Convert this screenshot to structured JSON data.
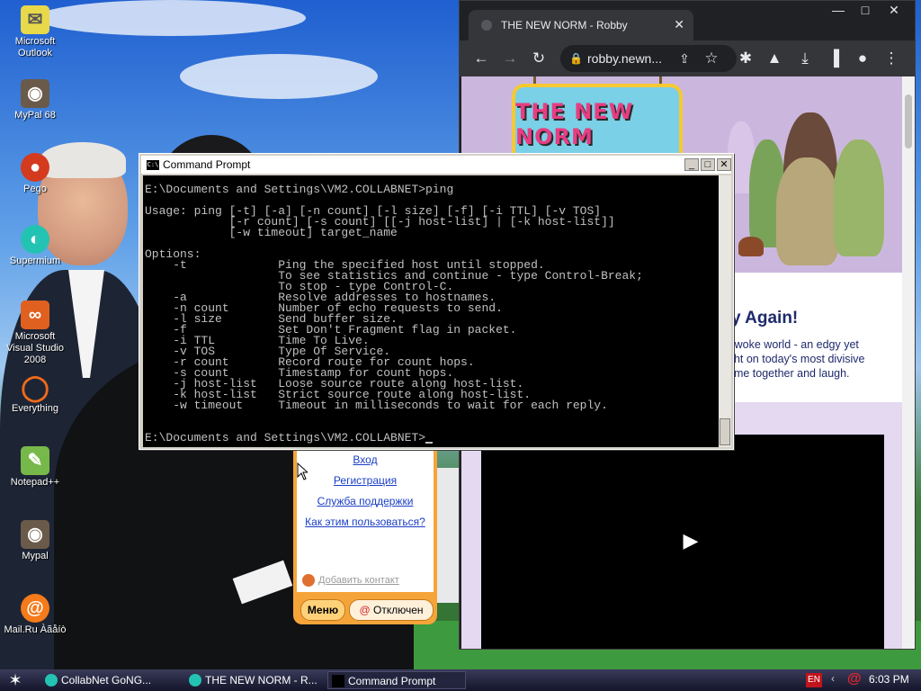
{
  "desktop": {
    "icons": [
      {
        "label": "Microsoft Outlook",
        "icon": "outlook-icon",
        "color": "#e8d94a"
      },
      {
        "label": "MyPal 68",
        "icon": "raccoon-icon",
        "color": "#6a5a4a"
      },
      {
        "label": "Pego",
        "icon": "pego-icon",
        "color": "#d33a1e"
      },
      {
        "label": "Supermium",
        "icon": "supermium-icon",
        "color": "#23c3b3"
      },
      {
        "label": "Microsoft Visual Studio 2008",
        "icon": "visual-studio-icon",
        "color": "#e06020"
      },
      {
        "label": "Everything",
        "icon": "search-icon",
        "color": "#f06a1a"
      },
      {
        "label": "Notepad++",
        "icon": "notepadpp-icon",
        "color": "#77b84a"
      },
      {
        "label": "Mypal",
        "icon": "raccoon-icon",
        "color": "#6a5a4a"
      },
      {
        "label": "Mail.Ru Àãåíò",
        "icon": "mailru-at-icon",
        "color": "#f47a1a"
      }
    ]
  },
  "browser": {
    "tab_title": "THE NEW NORM - Robby",
    "url": "robby.newn...",
    "page": {
      "logo_text": "THE NEW NORM",
      "headline": "y Again!",
      "blurb_lines": [
        "r woke world - an edgy yet",
        "ght on today's most divisive",
        "ome together and laugh."
      ]
    }
  },
  "messenger": {
    "links": [
      "Вход",
      "Регистрация",
      "Служба поддержки",
      "Как этим пользоваться?"
    ],
    "add_contact": "Добавить контакт",
    "menu_button": "Меню",
    "status_button": "Отключен",
    "accent_color": "#f5a43a"
  },
  "cmd": {
    "title": "Command Prompt",
    "icon_label": "C:\\",
    "lines": [
      "E:\\Documents and Settings\\VM2.COLLABNET>ping",
      "",
      "Usage: ping [-t] [-a] [-n count] [-l size] [-f] [-i TTL] [-v TOS]",
      "            [-r count] [-s count] [[-j host-list] | [-k host-list]]",
      "            [-w timeout] target_name",
      "",
      "Options:",
      "    -t             Ping the specified host until stopped.",
      "                   To see statistics and continue - type Control-Break;",
      "                   To stop - type Control-C.",
      "    -a             Resolve addresses to hostnames.",
      "    -n count       Number of echo requests to send.",
      "    -l size        Send buffer size.",
      "    -f             Set Don't Fragment flag in packet.",
      "    -i TTL         Time To Live.",
      "    -v TOS         Type Of Service.",
      "    -r count       Record route for count hops.",
      "    -s count       Timestamp for count hops.",
      "    -j host-list   Loose source route along host-list.",
      "    -k host-list   Strict source route along host-list.",
      "    -w timeout     Timeout in milliseconds to wait for each reply.",
      "",
      ""
    ],
    "prompt": "E:\\Documents and Settings\\VM2.COLLABNET>"
  },
  "taskbar": {
    "tasks": [
      {
        "label": "CollabNet GoNG...",
        "icon_color": "#23c3b3",
        "active": false
      },
      {
        "label": "THE NEW NORM - R...",
        "icon_color": "#23c3b3",
        "active": false
      },
      {
        "label": "Command Prompt",
        "icon_color": "#000000",
        "active": true
      }
    ],
    "lang": "EN",
    "clock": "6:03 PM"
  }
}
